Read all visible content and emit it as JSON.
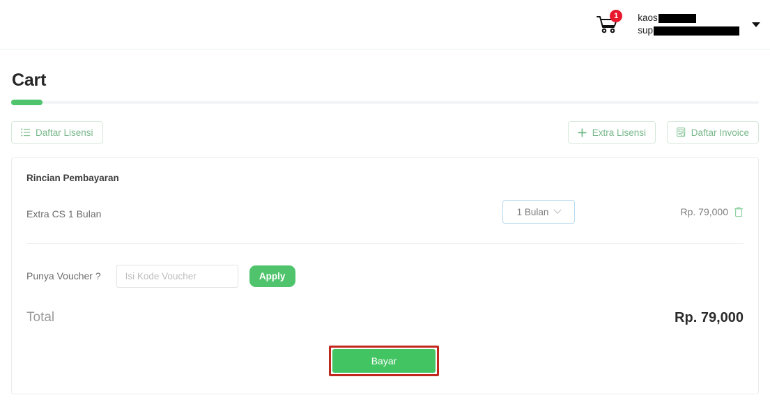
{
  "topbar": {
    "cart_icon": "shopping-cart-icon",
    "cart_badge_count": "1",
    "user_name_visible": "kaos",
    "user_email_visible": "sup",
    "dropdown_icon": "caret-down-icon"
  },
  "page": {
    "title": "Cart",
    "progress_percent": "4"
  },
  "actions": {
    "daftar_lisensi": {
      "label": "Daftar Lisensi",
      "icon": "list-icon"
    },
    "extra_lisensi": {
      "label": "Extra Lisensi",
      "icon": "plus-icon"
    },
    "daftar_invoice": {
      "label": "Daftar Invoice",
      "icon": "invoice-icon"
    }
  },
  "card": {
    "title": "Rincian Pembayaran",
    "item": {
      "name": "Extra CS 1 Bulan",
      "duration_selected": "1 Bulan",
      "duration_icon": "chevron-down-icon",
      "price": "Rp. 79,000",
      "delete_icon": "trash-icon"
    },
    "voucher": {
      "label": "Punya Voucher ?",
      "input_value": "",
      "placeholder": "Isi Kode Voucher",
      "apply_label": "Apply"
    },
    "total": {
      "label": "Total",
      "value": "Rp. 79,000"
    },
    "pay_button": {
      "label": "Bayar"
    }
  },
  "colors": {
    "green": "#4fc46d",
    "pay_green": "#43c463",
    "badge_red": "#e8192c",
    "highlight_red": "#c0281e",
    "select_border_blue": "#b8daf0"
  }
}
